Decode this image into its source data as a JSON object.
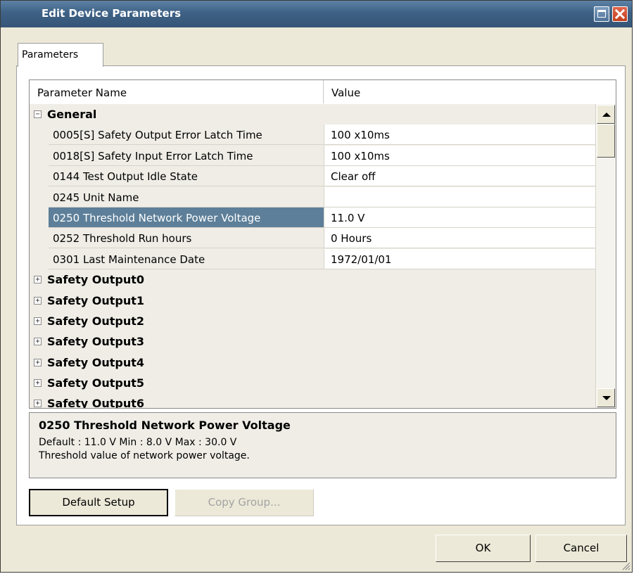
{
  "window": {
    "title": "Edit Device Parameters",
    "icons": [
      "maximize-icon",
      "close-icon"
    ]
  },
  "tabs": [
    {
      "label": "Parameters",
      "active": true
    }
  ],
  "grid": {
    "columns": [
      "Parameter Name",
      "Value"
    ],
    "groups": [
      {
        "name": "General",
        "expanded": true,
        "params": [
          {
            "name": "0005[S] Safety Output Error Latch Time",
            "value": "100 x10ms"
          },
          {
            "name": "0018[S] Safety Input Error Latch Time",
            "value": "100 x10ms"
          },
          {
            "name": "0144 Test Output Idle State",
            "value": "Clear off"
          },
          {
            "name": "0245 Unit Name",
            "value": ""
          },
          {
            "name": "0250 Threshold Network Power Voltage",
            "value": "11.0 V",
            "selected": true
          },
          {
            "name": "0252 Threshold Run hours",
            "value": "0 Hours"
          },
          {
            "name": "0301 Last Maintenance Date",
            "value": "1972/01/01"
          }
        ]
      },
      {
        "name": "Safety Output0",
        "expanded": false
      },
      {
        "name": "Safety Output1",
        "expanded": false
      },
      {
        "name": "Safety Output2",
        "expanded": false
      },
      {
        "name": "Safety Output3",
        "expanded": false
      },
      {
        "name": "Safety Output4",
        "expanded": false
      },
      {
        "name": "Safety Output5",
        "expanded": false
      },
      {
        "name": "Safety Output6",
        "expanded": false
      }
    ]
  },
  "description": {
    "title": "0250 Threshold Network Power Voltage",
    "line1": "Default : 11.0 V  Min : 8.0 V  Max : 30.0 V",
    "line2": "Threshold value of network power voltage."
  },
  "buttons": {
    "default_setup": "Default Setup",
    "copy_group": "Copy Group...",
    "ok": "OK",
    "cancel": "Cancel"
  },
  "colors": {
    "titlebar": "#3e6185",
    "selection": "#5d7f99",
    "window_bg": "#ece9d8"
  }
}
